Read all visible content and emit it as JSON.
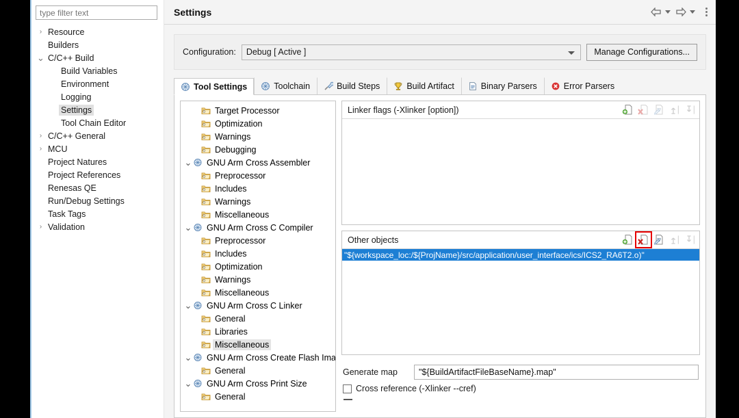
{
  "sidebar": {
    "filter_placeholder": "type filter text",
    "items": [
      {
        "label": "Resource",
        "twisty": ">",
        "indent": 0,
        "selected": false
      },
      {
        "label": "Builders",
        "twisty": "",
        "indent": 0,
        "selected": false
      },
      {
        "label": "C/C++ Build",
        "twisty": "v",
        "indent": 0,
        "selected": false
      },
      {
        "label": "Build Variables",
        "twisty": "",
        "indent": 1,
        "selected": false
      },
      {
        "label": "Environment",
        "twisty": "",
        "indent": 1,
        "selected": false
      },
      {
        "label": "Logging",
        "twisty": "",
        "indent": 1,
        "selected": false
      },
      {
        "label": "Settings",
        "twisty": "",
        "indent": 1,
        "selected": true
      },
      {
        "label": "Tool Chain Editor",
        "twisty": "",
        "indent": 1,
        "selected": false
      },
      {
        "label": "C/C++ General",
        "twisty": ">",
        "indent": 0,
        "selected": false
      },
      {
        "label": "MCU",
        "twisty": ">",
        "indent": 0,
        "selected": false
      },
      {
        "label": "Project Natures",
        "twisty": "",
        "indent": 0,
        "selected": false
      },
      {
        "label": "Project References",
        "twisty": "",
        "indent": 0,
        "selected": false
      },
      {
        "label": "Renesas QE",
        "twisty": "",
        "indent": 0,
        "selected": false
      },
      {
        "label": "Run/Debug Settings",
        "twisty": "",
        "indent": 0,
        "selected": false
      },
      {
        "label": "Task Tags",
        "twisty": "",
        "indent": 0,
        "selected": false
      },
      {
        "label": "Validation",
        "twisty": ">",
        "indent": 0,
        "selected": false
      }
    ]
  },
  "header": {
    "title": "Settings",
    "back_icon": "back-arrow-icon",
    "forward_icon": "forward-arrow-icon",
    "menu_icon": "view-menu-icon"
  },
  "configuration": {
    "label": "Configuration:",
    "selected_value": "Debug  [ Active ]",
    "manage_button": "Manage Configurations..."
  },
  "tabs": [
    {
      "label": "Tool Settings",
      "icon": "tool-settings-icon",
      "active": true
    },
    {
      "label": "Toolchain",
      "icon": "toolchain-icon",
      "active": false
    },
    {
      "label": "Build Steps",
      "icon": "build-steps-icon",
      "active": false
    },
    {
      "label": "Build Artifact",
      "icon": "build-artifact-icon",
      "active": false
    },
    {
      "label": "Binary Parsers",
      "icon": "binary-parsers-icon",
      "active": false
    },
    {
      "label": "Error Parsers",
      "icon": "error-parsers-icon",
      "active": false
    }
  ],
  "option_tree": [
    {
      "label": "Target Processor",
      "twisty": "",
      "indent": 1,
      "icon": "option-folder-icon",
      "selected": false
    },
    {
      "label": "Optimization",
      "twisty": "",
      "indent": 1,
      "icon": "option-folder-icon",
      "selected": false
    },
    {
      "label": "Warnings",
      "twisty": "",
      "indent": 1,
      "icon": "option-folder-icon",
      "selected": false
    },
    {
      "label": "Debugging",
      "twisty": "",
      "indent": 1,
      "icon": "option-folder-icon",
      "selected": false
    },
    {
      "label": "GNU Arm Cross Assembler",
      "twisty": "v",
      "indent": 0,
      "icon": "tool-node-icon",
      "selected": false
    },
    {
      "label": "Preprocessor",
      "twisty": "",
      "indent": 1,
      "icon": "option-folder-icon",
      "selected": false
    },
    {
      "label": "Includes",
      "twisty": "",
      "indent": 1,
      "icon": "option-folder-icon",
      "selected": false
    },
    {
      "label": "Warnings",
      "twisty": "",
      "indent": 1,
      "icon": "option-folder-icon",
      "selected": false
    },
    {
      "label": "Miscellaneous",
      "twisty": "",
      "indent": 1,
      "icon": "option-folder-icon",
      "selected": false
    },
    {
      "label": "GNU Arm Cross C Compiler",
      "twisty": "v",
      "indent": 0,
      "icon": "tool-node-icon",
      "selected": false
    },
    {
      "label": "Preprocessor",
      "twisty": "",
      "indent": 1,
      "icon": "option-folder-icon",
      "selected": false
    },
    {
      "label": "Includes",
      "twisty": "",
      "indent": 1,
      "icon": "option-folder-icon",
      "selected": false
    },
    {
      "label": "Optimization",
      "twisty": "",
      "indent": 1,
      "icon": "option-folder-icon",
      "selected": false
    },
    {
      "label": "Warnings",
      "twisty": "",
      "indent": 1,
      "icon": "option-folder-icon",
      "selected": false
    },
    {
      "label": "Miscellaneous",
      "twisty": "",
      "indent": 1,
      "icon": "option-folder-icon",
      "selected": false
    },
    {
      "label": "GNU Arm Cross C Linker",
      "twisty": "v",
      "indent": 0,
      "icon": "tool-node-icon",
      "selected": false
    },
    {
      "label": "General",
      "twisty": "",
      "indent": 1,
      "icon": "option-folder-icon",
      "selected": false
    },
    {
      "label": "Libraries",
      "twisty": "",
      "indent": 1,
      "icon": "option-folder-icon",
      "selected": false
    },
    {
      "label": "Miscellaneous",
      "twisty": "",
      "indent": 1,
      "icon": "option-folder-icon",
      "selected": true
    },
    {
      "label": "GNU Arm Cross Create Flash Image",
      "twisty": "v",
      "indent": 0,
      "icon": "tool-node-icon",
      "selected": false
    },
    {
      "label": "General",
      "twisty": "",
      "indent": 1,
      "icon": "option-folder-icon",
      "selected": false
    },
    {
      "label": "GNU Arm Cross Print Size",
      "twisty": "v",
      "indent": 0,
      "icon": "tool-node-icon",
      "selected": false
    },
    {
      "label": "General",
      "twisty": "",
      "indent": 1,
      "icon": "option-folder-icon",
      "selected": false
    }
  ],
  "linker_flags": {
    "title": "Linker flags (-Xlinker [option])",
    "items": [],
    "tools": [
      {
        "name": "add-icon",
        "enabled": true
      },
      {
        "name": "delete-icon",
        "enabled": false
      },
      {
        "name": "edit-icon",
        "enabled": false
      },
      {
        "name": "move-up-icon",
        "enabled": false
      },
      {
        "name": "move-down-icon",
        "enabled": false
      }
    ]
  },
  "other_objects": {
    "title": "Other objects",
    "items": [
      {
        "value": "\"${workspace_loc:/${ProjName}/src/application/user_interface/ics/ICS2_RA6T2.o)\"",
        "selected": true
      }
    ],
    "tools": [
      {
        "name": "add-icon",
        "enabled": true,
        "highlighted": false
      },
      {
        "name": "delete-icon",
        "enabled": true,
        "highlighted": true
      },
      {
        "name": "edit-icon",
        "enabled": true,
        "highlighted": false
      },
      {
        "name": "move-up-icon",
        "enabled": false,
        "highlighted": false
      },
      {
        "name": "move-down-icon",
        "enabled": false,
        "highlighted": false
      }
    ]
  },
  "bottom_options": {
    "generate_map_label": "Generate map",
    "generate_map_value": "\"${BuildArtifactFileBaseName}.map\"",
    "cross_reference_label": "Cross reference (-Xlinker --cref)",
    "cross_reference_checked": false
  },
  "colors": {
    "selection_blue": "#1d7fd4",
    "highlight_red": "#e60000",
    "accent_blue": "#8cc0e6"
  }
}
